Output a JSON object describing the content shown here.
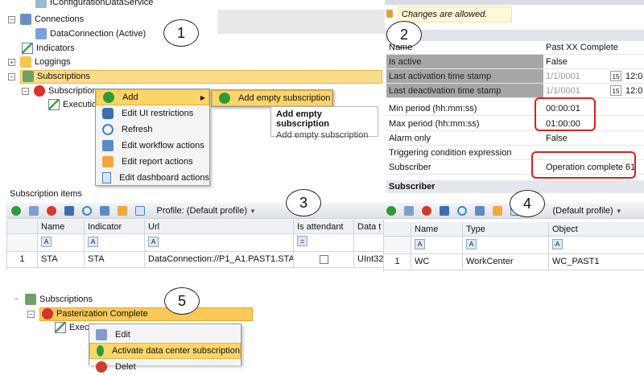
{
  "tree": {
    "items": [
      {
        "label": "IConfigurationDataService",
        "icon": "service-icon"
      },
      {
        "label": "Connections",
        "icon": "connections-icon"
      },
      {
        "label": "DataConnection (Active)",
        "icon": "data-connection-icon"
      },
      {
        "label": "Indicators",
        "icon": "indicator-icon"
      },
      {
        "label": "Loggings",
        "icon": "logging-icon"
      },
      {
        "label": "Subscriptions",
        "icon": "subscriptions-icon"
      },
      {
        "label": "Subscription",
        "icon": "stop-icon"
      },
      {
        "label": "Executio",
        "icon": "chart-icon"
      }
    ]
  },
  "context_menu": {
    "items": [
      "Add",
      "Edit UI restrictions",
      "Refresh",
      "Edit workflow actions",
      "Edit report actions",
      "Edit dashboard actions"
    ]
  },
  "submenu": {
    "item": "Add empty subscription"
  },
  "tooltip": {
    "title": "Add empty subscription",
    "body": "Add empty subscription"
  },
  "properties": {
    "notice": "Changes are allowed.",
    "header_name": "Name",
    "header_value": "Past XX Complete",
    "rows": [
      {
        "key": "Is active",
        "value": "False"
      },
      {
        "key": "Last activation time stamp",
        "value": "1/1/0001",
        "time": "12:0"
      },
      {
        "key": "Last deactivation time stamp",
        "value": "1/1/0001",
        "time": "12:0"
      },
      {
        "key": "Min period (hh:mm:ss)",
        "value": "00:00:01"
      },
      {
        "key": "Max period (hh:mm:ss)",
        "value": "01:00:00"
      },
      {
        "key": "Alarm only",
        "value": "False"
      },
      {
        "key": "Triggering condition expression",
        "value": ""
      },
      {
        "key": "Subscriber",
        "value": "Operation complete 61"
      }
    ],
    "section": "Subscriber",
    "calendar_label": "15"
  },
  "subscription_items": {
    "title": "Subscription items",
    "profile": "Profile: (Default profile)",
    "columns": [
      "Name",
      "Indicator",
      "Url",
      "Is attendant",
      "Data t"
    ],
    "row": {
      "index": "1",
      "name": "STA",
      "indicator": "STA",
      "url": "DataConnection://P1_A1.PAST1.STA",
      "data_type": "UInt32"
    }
  },
  "subscriber_grid": {
    "profile": "(Default profile)",
    "columns": [
      "Name",
      "Type",
      "Object"
    ],
    "row": {
      "index": "1",
      "name": "WC",
      "type": "WorkCenter",
      "object": "WC_PAST1"
    }
  },
  "tree2": {
    "subscriptions": "Subscriptions",
    "selected": "Pasterization Complete",
    "exec": "Execu"
  },
  "context_menu2": {
    "items": [
      "Edit",
      "Activate data center subscription",
      "Delet"
    ]
  },
  "callouts": [
    "1",
    "2",
    "3",
    "4",
    "5"
  ],
  "colors": {
    "highlight": "#fbd56a",
    "red_box": "#e01d1d",
    "gray_cell": "#a6a6a6"
  }
}
